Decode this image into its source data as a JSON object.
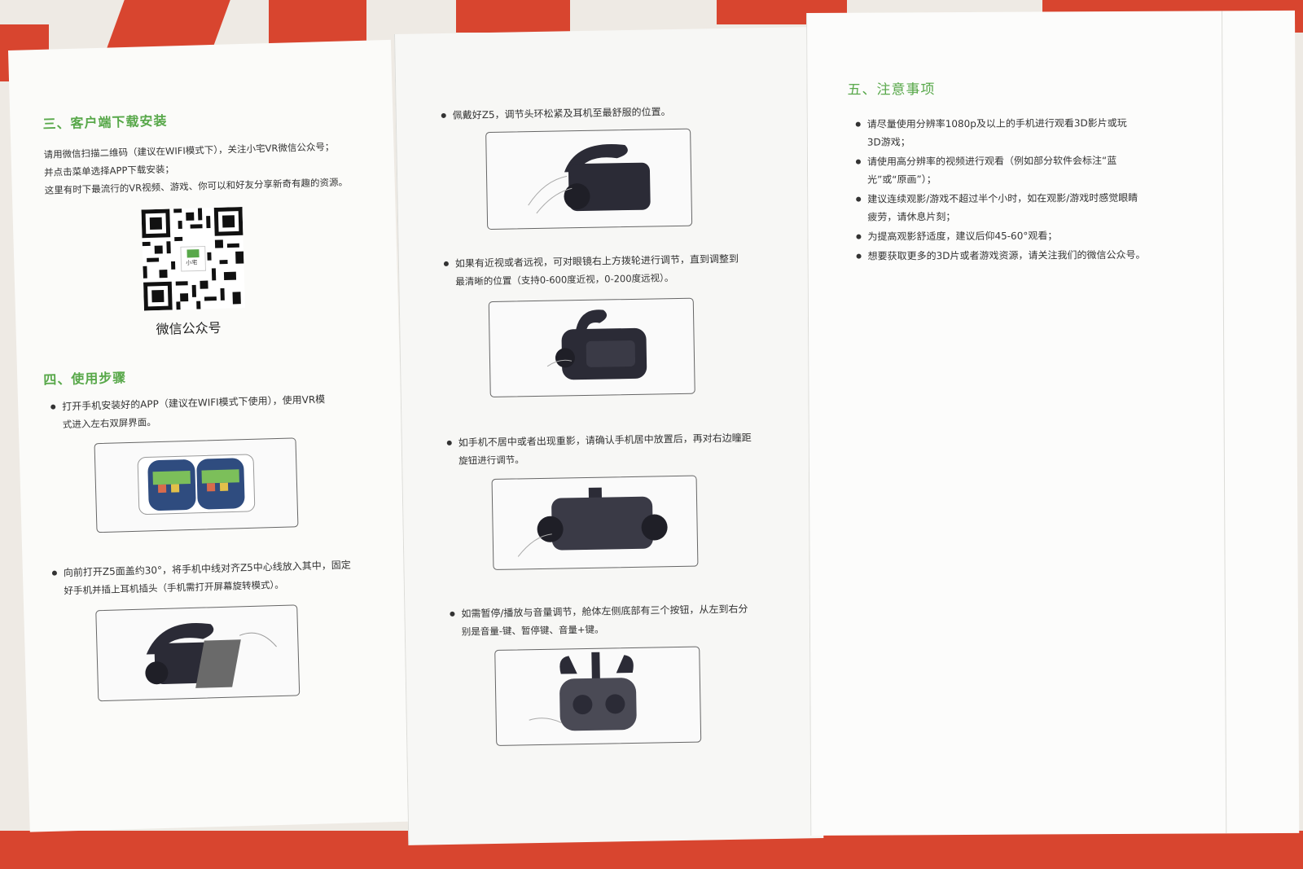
{
  "colors": {
    "heading": "#58a84a",
    "text": "#333333"
  },
  "left_panel": {
    "heading_download": "三、客户端下载安装",
    "download_lines": [
      "请用微信扫描二维码（建议在WIFI模式下），关注小宅VR微信公众号；",
      "并点击菜单选择APP下载安装；",
      "这里有时下最流行的VR视频、游戏、你可以和好友分享新奇有趣的资源。"
    ],
    "qr_caption": "微信公众号",
    "qr_logo_text": "小宅",
    "heading_steps": "四、使用步骤",
    "step1": [
      "打开手机安装好的APP（建议在WIFI模式下使用），使用VR模",
      "式进入左右双屏界面。"
    ],
    "step2": [
      "向前打开Z5面盖约30°，将手机中线对齐Z5中心线放入其中，固定",
      "好手机并插上耳机插头（手机需打开屏幕旋转模式）。"
    ]
  },
  "middle_panel": {
    "step3": [
      "佩戴好Z5，调节头环松紧及耳机至最舒服的位置。"
    ],
    "step4": [
      "如果有近视或者远视，可对眼镜右上方拨轮进行调节，直到调整到",
      "最清晰的位置（支持0-600度近视，0-200度远视）。"
    ],
    "step5": [
      "如手机不居中或者出现重影，请确认手机居中放置后，再对右边瞳距",
      "旋钮进行调节。"
    ],
    "step6": [
      "如需暂停/播放与音量调节，舱体左侧底部有三个按钮，从左到右分",
      "别是音量-键、暂停键、音量+键。"
    ]
  },
  "right_panel": {
    "heading_notes": "五、注意事项",
    "note1": [
      "请尽量使用分辨率1080p及以上的手机进行观看3D影片或玩",
      "3D游戏；"
    ],
    "note2": [
      "请使用高分辨率的视频进行观看（例如部分软件会标注“蓝",
      "光”或“原画”）；"
    ],
    "note3": [
      "建议连续观影/游戏不超过半个小时，如在观影/游戏时感觉眼睛",
      "疲劳，请休息片刻；"
    ],
    "note4": [
      "为提高观影舒适度，建议后仰45-60°观看；"
    ],
    "note5": [
      "想要获取更多的3D片或者游戏资源，请关注我们的微信公众号。"
    ]
  }
}
